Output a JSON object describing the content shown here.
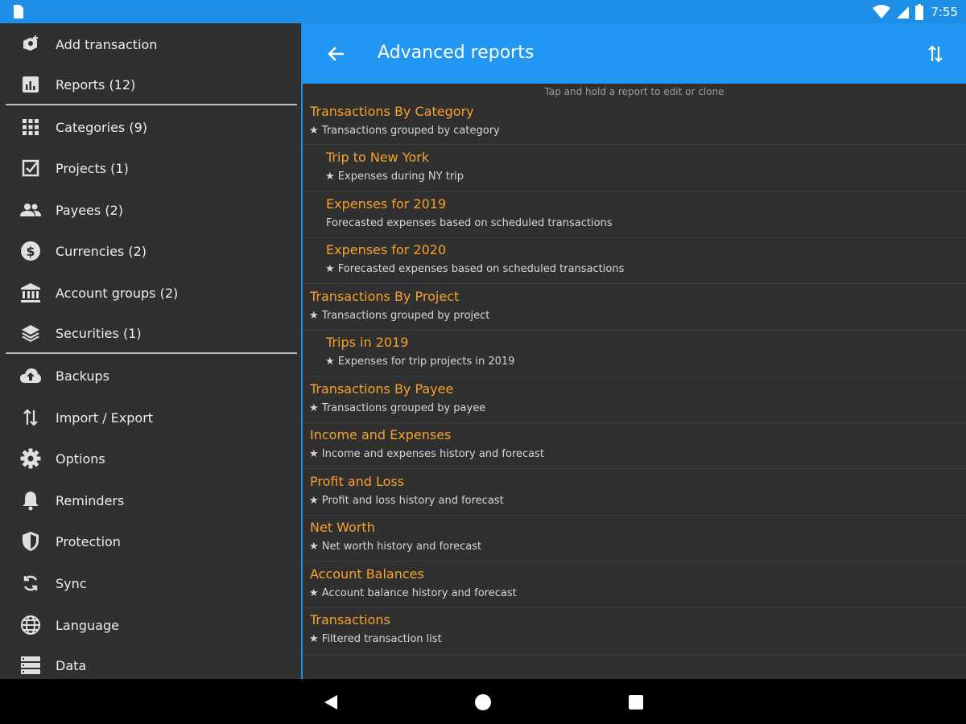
{
  "status_bar": {
    "time": "7:55",
    "icons": [
      "sim-card-icon",
      "wifi-icon",
      "signal-icon",
      "battery-icon"
    ]
  },
  "drawer": {
    "items": [
      {
        "label": "Add transaction",
        "icon": "add-transaction-icon"
      },
      {
        "label": "Reports (12)",
        "icon": "reports-icon"
      },
      {
        "label": "Categories (9)",
        "icon": "categories-icon"
      },
      {
        "label": "Projects (1)",
        "icon": "projects-icon"
      },
      {
        "label": "Payees (2)",
        "icon": "payees-icon"
      },
      {
        "label": "Currencies (2)",
        "icon": "currencies-icon"
      },
      {
        "label": "Account groups (2)",
        "icon": "account-groups-icon"
      },
      {
        "label": "Securities (1)",
        "icon": "securities-icon"
      },
      {
        "label": "Backups",
        "icon": "cloud-upload-icon"
      },
      {
        "label": "Import / Export",
        "icon": "import-export-icon"
      },
      {
        "label": "Options",
        "icon": "gear-icon"
      },
      {
        "label": "Reminders",
        "icon": "bell-icon"
      },
      {
        "label": "Protection",
        "icon": "shield-icon"
      },
      {
        "label": "Sync",
        "icon": "sync-icon"
      },
      {
        "label": "Language",
        "icon": "globe-icon"
      },
      {
        "label": "Data",
        "icon": "data-icon"
      }
    ]
  },
  "appbar": {
    "title": "Advanced reports"
  },
  "hint": "Tap and hold a report to edit or clone",
  "reports": [
    {
      "title": "Transactions By Category",
      "subtitle": "★ Transactions grouped by category",
      "indent": false
    },
    {
      "title": "Trip to New York",
      "subtitle": "★ Expenses during NY trip",
      "indent": true
    },
    {
      "title": "Expenses for 2019",
      "subtitle": "Forecasted expenses based on scheduled transactions",
      "indent": true
    },
    {
      "title": "Expenses for 2020",
      "subtitle": "★ Forecasted expenses based on scheduled transactions",
      "indent": true
    },
    {
      "title": "Transactions By Project",
      "subtitle": "★ Transactions grouped by project",
      "indent": false
    },
    {
      "title": "Trips in 2019",
      "subtitle": "★ Expenses for trip projects in 2019",
      "indent": true
    },
    {
      "title": "Transactions By Payee",
      "subtitle": "★ Transactions grouped by payee",
      "indent": false
    },
    {
      "title": "Income and Expenses",
      "subtitle": "★ Income and expenses history and forecast",
      "indent": false
    },
    {
      "title": "Profit and Loss",
      "subtitle": "★ Profit and loss history and forecast",
      "indent": false
    },
    {
      "title": "Net Worth",
      "subtitle": "★ Net worth history and forecast",
      "indent": false
    },
    {
      "title": "Account Balances",
      "subtitle": "★ Account balance history and forecast",
      "indent": false
    },
    {
      "title": "Transactions",
      "subtitle": "★ Filtered transaction list",
      "indent": false
    }
  ],
  "colors": {
    "accent": "#2196f3",
    "status_bar": "#1e8fe6",
    "report_title": "#f7a22a",
    "background": "#303030"
  }
}
